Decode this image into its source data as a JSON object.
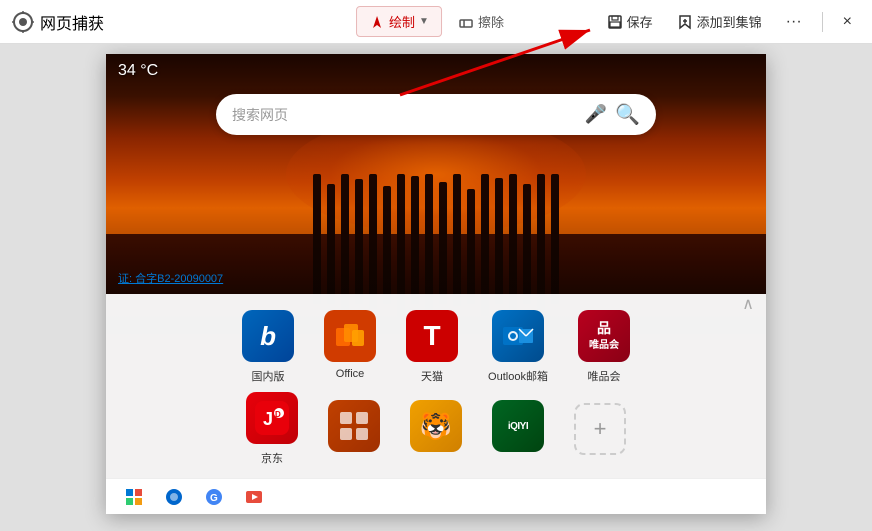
{
  "toolbar": {
    "logo_label": "网页捕获",
    "draw_label": "绘制",
    "erase_label": "擦除",
    "save_label": "保存",
    "add_to_collect_label": "添加到集锦",
    "more_label": "···",
    "close_label": "×"
  },
  "browser": {
    "temperature": "34 °C",
    "search_placeholder": "搜索网页",
    "license_text": "证: 合字B2-20090007"
  },
  "apps": {
    "row1": [
      {
        "name": "国内版",
        "bg": "#0066cc",
        "letter": "b",
        "font_size": "28px",
        "color": "#fff",
        "bg_color": "#0066cc"
      },
      {
        "name": "Office",
        "bg": "#d03b00",
        "letter": "◱",
        "font_size": "24px",
        "color": "#fff",
        "bg_color": "#d03b00"
      },
      {
        "name": "天猫",
        "bg": "#cc0000",
        "letter": "T",
        "font_size": "28px",
        "color": "#fff",
        "bg_color": "#cc0000"
      },
      {
        "name": "Outlook邮箱",
        "bg": "#0072c6",
        "letter": "Ol",
        "font_size": "18px",
        "color": "#fff",
        "bg_color": "#0072c6"
      },
      {
        "name": "唯品会",
        "bg": "#c0002a",
        "letter": "品",
        "font_size": "18px",
        "color": "#fff",
        "bg_color": "#a00020"
      }
    ],
    "row2": [
      {
        "name": "京东",
        "bg": "#e00000",
        "letter": "J",
        "font_size": "26px",
        "color": "#fff",
        "bg_color": "#e00000"
      },
      {
        "name": "",
        "bg": "#e05000",
        "letter": "▦",
        "font_size": "22px",
        "color": "#fff",
        "bg_color": "#c04000"
      },
      {
        "name": "",
        "bg": "#f0a000",
        "letter": "🐯",
        "font_size": "22px",
        "color": "#fff",
        "bg_color": "#f0a000"
      },
      {
        "name": "",
        "bg": "#00aa44",
        "letter": "iQIYI",
        "font_size": "10px",
        "color": "#fff",
        "bg_color": "#006622"
      }
    ],
    "add_label": "+"
  },
  "taskbar": {
    "icons": [
      "⊞",
      "🔵",
      "G",
      "▶"
    ]
  }
}
